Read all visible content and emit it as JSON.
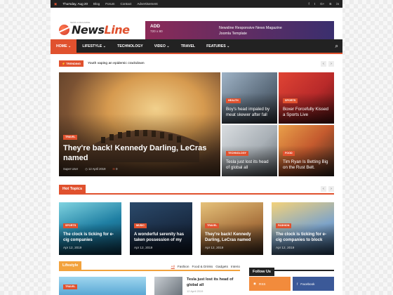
{
  "topbar": {
    "date": "Thursday, Aug 20",
    "links": [
      "Blog",
      "Forum",
      "Contact",
      "Advertisement"
    ],
    "social": [
      "f",
      "t",
      "G+",
      "B",
      "in"
    ]
  },
  "logo": {
    "news": "News",
    "line": "Line",
    "tagline": "NEWS & MAGAZINE"
  },
  "ad": {
    "title": "ADD",
    "size": "720 x 80",
    "text1": "Newsline Responsive News Magazine",
    "text2": "Joomla Template"
  },
  "nav": {
    "items": [
      "HOME",
      "LIFESTYLE",
      "TECHNOLOGY",
      "VIDEO",
      "TRAVEL",
      "FEATURES"
    ]
  },
  "trending": {
    "label": "TRENDING",
    "headline": "Youth vaping an epidemic crackdown"
  },
  "featured": {
    "main": {
      "category": "TRAVEL",
      "title": "They're back! Kennedy Darling, LeCras named",
      "author": "Super User",
      "date": "12 April 2019",
      "comments": "0"
    },
    "tiles": [
      {
        "category": "HEALTH",
        "title": "Boy's head impaled by meat skewer after fall"
      },
      {
        "category": "SPORTS",
        "title": "Boxer Forcefully Kissed a Sports Live"
      },
      {
        "category": "TECHNOLOGY",
        "title": "Tesla just lost its head of global all"
      },
      {
        "category": "FOOD",
        "title": "Tim Ryan Is Betting Big on the Rust Belt."
      }
    ]
  },
  "hot_topics": {
    "title": "Hot Topics",
    "items": [
      {
        "category": "SPORTS",
        "title": "The clock is ticking for e-cig companies",
        "date": "Apr 12, 2019"
      },
      {
        "category": "MUSIC",
        "title": "A wonderful serenity has taken possession of my",
        "date": "Apr 12, 2019"
      },
      {
        "category": "TRAVEL",
        "title": "They're back! Kennedy Darling, LeCras named",
        "date": "Apr 12, 2019"
      },
      {
        "category": "FASHION",
        "title": "The clock is ticking for e-cig companies to block",
        "date": "Apr 12, 2019"
      }
    ]
  },
  "lifestyle": {
    "title": "Lifestyle",
    "tabs": [
      "All",
      "Fashion",
      "Food & Drinks",
      "Gadgets",
      "Interio"
    ],
    "tile_category": "TRAVEL",
    "side_title": "Tesla just lost its head of global all",
    "side_date": "12 April 2019"
  },
  "follow": {
    "title": "Follow Us",
    "rss": "RSS",
    "facebook": "Facebook"
  },
  "colors": {
    "accent": "#e0512e",
    "dark": "#222222",
    "lifestyle": "#f2a23c"
  }
}
